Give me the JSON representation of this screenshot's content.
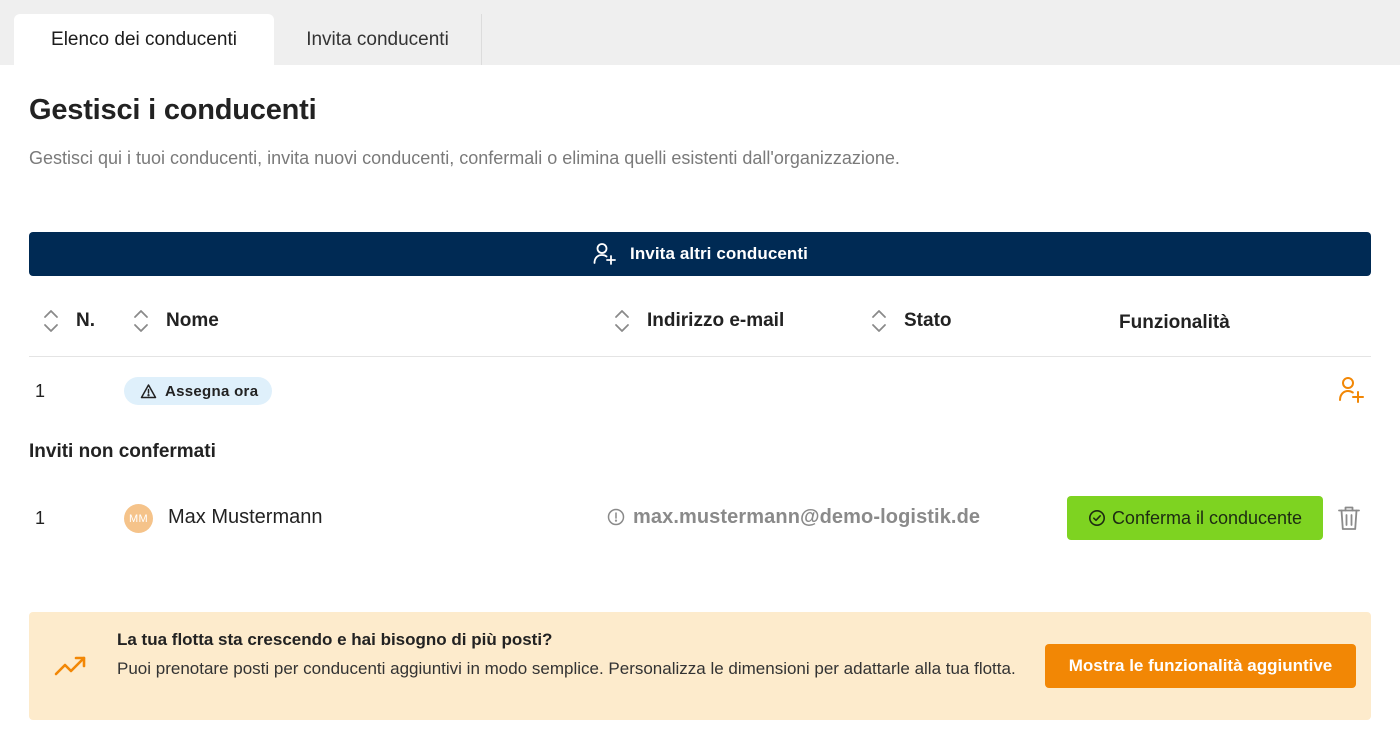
{
  "tabs": [
    {
      "label": "Elenco dei conducenti",
      "active": true
    },
    {
      "label": "Invita conducenti",
      "active": false
    }
  ],
  "page": {
    "title": "Gestisci i conducenti",
    "description": "Gestisci qui i tuoi conducenti, invita nuovi conducenti, confermali o elimina quelli esistenti dall'organizzazione."
  },
  "invite_bar": {
    "label": "Invita altri conducenti",
    "icon": "user-plus-icon",
    "color": "#002a54"
  },
  "table": {
    "columns": [
      "N.",
      "Nome",
      "Indirizzo e-mail",
      "Stato",
      "Funzionalità"
    ],
    "rows": [
      {
        "number": "1",
        "badge": "Assegna ora",
        "badge_icon": "warning-icon",
        "action_icon": "user-plus-icon"
      }
    ]
  },
  "unconfirmed": {
    "title": "Inviti non confermati",
    "rows": [
      {
        "number": "1",
        "initials": "MM",
        "name": "Max Mustermann",
        "email": "max.mustermann@demo-logistik.de",
        "confirm_label": "Conferma il conducente",
        "confirm_color": "#7ed321"
      }
    ]
  },
  "promo": {
    "title": "La tua flotta sta crescendo e hai bisogno di più posti?",
    "text": "Puoi prenotare posti per conducenti aggiuntivi in modo semplice. Personalizza le dimensioni per adattarle alla tua flotta.",
    "button_label": "Mostra le funzionalità aggiuntive",
    "icon": "trending-up-icon",
    "accent": "#f28705",
    "background": "#fdebcc"
  }
}
